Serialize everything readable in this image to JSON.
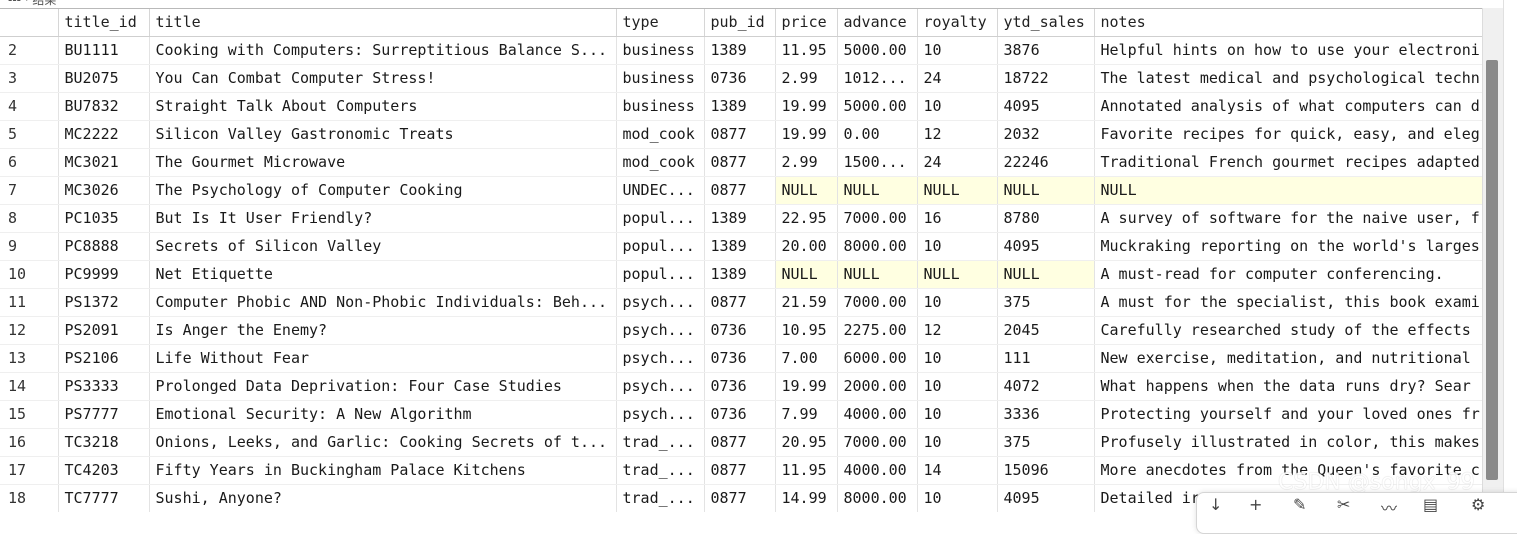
{
  "top_label": "--- · 结果",
  "columns": [
    "",
    "title_id",
    "title",
    "type",
    "pub_id",
    "price",
    "advance",
    "royalty",
    "ytd_sales",
    "notes"
  ],
  "null_text": "NULL",
  "rows": [
    [
      "2",
      "BU1111",
      "Cooking with Computers: Surreptitious Balance S...",
      "business",
      "1389",
      "11.95",
      "5000.00",
      "10",
      "3876",
      "Helpful hints on how to use your electroni"
    ],
    [
      "3",
      "BU2075",
      "You Can Combat Computer Stress!",
      "business",
      "0736",
      "2.99",
      "1012...",
      "24",
      "18722",
      "The latest medical and psychological techn"
    ],
    [
      "4",
      "BU7832",
      "Straight Talk About Computers",
      "business",
      "1389",
      "19.99",
      "5000.00",
      "10",
      "4095",
      "Annotated analysis of what computers can d"
    ],
    [
      "5",
      "MC2222",
      "Silicon Valley Gastronomic Treats",
      "mod_cook",
      "0877",
      "19.99",
      "0.00",
      "12",
      "2032",
      "Favorite recipes for quick, easy, and eleg"
    ],
    [
      "6",
      "MC3021",
      "The Gourmet Microwave",
      "mod_cook",
      "0877",
      "2.99",
      "1500...",
      "24",
      "22246",
      "Traditional French gourmet recipes adapted"
    ],
    [
      "7",
      "MC3026",
      "The Psychology of Computer Cooking",
      "UNDEC...",
      "0877",
      "NULL",
      "NULL",
      "NULL",
      "NULL",
      "NULL"
    ],
    [
      "8",
      "PC1035",
      "But Is It User Friendly?",
      "popul...",
      "1389",
      "22.95",
      "7000.00",
      "16",
      "8780",
      "A survey of software for the naive user, f"
    ],
    [
      "9",
      "PC8888",
      "Secrets of Silicon Valley",
      "popul...",
      "1389",
      "20.00",
      "8000.00",
      "10",
      "4095",
      "Muckraking reporting on the world's larges"
    ],
    [
      "10",
      "PC9999",
      "Net Etiquette",
      "popul...",
      "1389",
      "NULL",
      "NULL",
      "NULL",
      "NULL",
      "A must-read for computer conferencing."
    ],
    [
      "11",
      "PS1372",
      "Computer Phobic AND Non-Phobic Individuals: Beh...",
      "psych...",
      "0877",
      "21.59",
      "7000.00",
      "10",
      "375",
      "A must for the specialist, this book exami"
    ],
    [
      "12",
      "PS2091",
      "Is Anger the Enemy?",
      "psych...",
      "0736",
      "10.95",
      "2275.00",
      "12",
      "2045",
      "Carefully researched study of the effects"
    ],
    [
      "13",
      "PS2106",
      "Life Without Fear",
      "psych...",
      "0736",
      "7.00",
      "6000.00",
      "10",
      "111",
      "New exercise, meditation, and nutritional"
    ],
    [
      "14",
      "PS3333",
      "Prolonged Data Deprivation: Four Case Studies",
      "psych...",
      "0736",
      "19.99",
      "2000.00",
      "10",
      "4072",
      "What happens when the data runs dry?  Sear"
    ],
    [
      "15",
      "PS7777",
      "Emotional Security: A New Algorithm",
      "psych...",
      "0736",
      "7.99",
      "4000.00",
      "10",
      "3336",
      "Protecting yourself and your loved ones fr"
    ],
    [
      "16",
      "TC3218",
      "Onions, Leeks, and Garlic: Cooking Secrets of t...",
      "trad_...",
      "0877",
      "20.95",
      "7000.00",
      "10",
      "375",
      "Profusely illustrated in color, this makes"
    ],
    [
      "17",
      "TC4203",
      "Fifty Years in Buckingham Palace Kitchens",
      "trad_...",
      "0877",
      "11.95",
      "4000.00",
      "14",
      "15096",
      "More anecdotes from the Queen's favorite c"
    ],
    [
      "18",
      "TC7777",
      "Sushi, Anyone?",
      "trad_...",
      "0877",
      "14.99",
      "8000.00",
      "10",
      "4095",
      "Detailed ir"
    ]
  ],
  "toolbar_icons": [
    "arrow-down-icon",
    "plus-icon",
    "pen-icon",
    "scissors-icon",
    "draw-icon",
    "chart-icon",
    "settings-icon"
  ],
  "toolbar_glyphs": [
    "↓",
    "+",
    "✎",
    "✂",
    "〰",
    "▤",
    "⚙"
  ],
  "watermark": "CSDN @songx_99",
  "colors": {
    "null_bg": "#ffffe1",
    "header_border": "#cfcfcf",
    "scroll_thumb": "#8a8a8a"
  }
}
